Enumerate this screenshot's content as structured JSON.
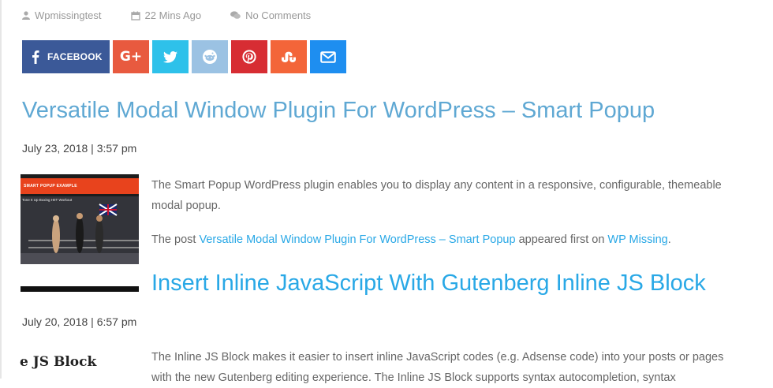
{
  "meta": {
    "author": "Wpmissingtest",
    "time_ago": "22 Mins Ago",
    "comments": "No Comments"
  },
  "share": {
    "facebook_label": "FACEBOOK",
    "gplus_label": "G+",
    "colors": {
      "facebook": "#3b5998",
      "gplus": "#e85a3f",
      "twitter": "#2ec1ea",
      "reddit": "#9bc2e3",
      "pinterest": "#d72d33",
      "stumbleupon": "#f36539",
      "email": "#1e8ef0"
    }
  },
  "posts": [
    {
      "title": "Versatile Modal Window Plugin For WordPress – Smart Popup",
      "date": "July 23, 2018 | 3:57 pm",
      "thumb_banner": "SMART POPUP EXAMPLE",
      "thumb_video_title": "Tone It Up Boxing HIIT Workout",
      "excerpt_lines": [
        "The Smart Popup WordPress plugin enables you to display any content in a responsive, configurable, themeable",
        "modal popup."
      ],
      "source_prefix": "The post",
      "source_link": "Versatile Modal Window Plugin For WordPress – Smart Popup",
      "source_middle": "appeared first on",
      "source_site": "WP Missing",
      "source_end": "."
    },
    {
      "title": "Insert Inline JavaScript With Gutenberg Inline JS Block",
      "date": "July 20, 2018 | 6:57 pm",
      "thumb_text": "e JS Block",
      "excerpt_lines": [
        "The Inline JS Block makes it easier to insert inline JavaScript codes (e.g. Adsense code) into your posts or pages",
        "with the new Gutenberg editing experience. The Inline JS Block supports syntax autocompletion, syntax"
      ]
    }
  ]
}
